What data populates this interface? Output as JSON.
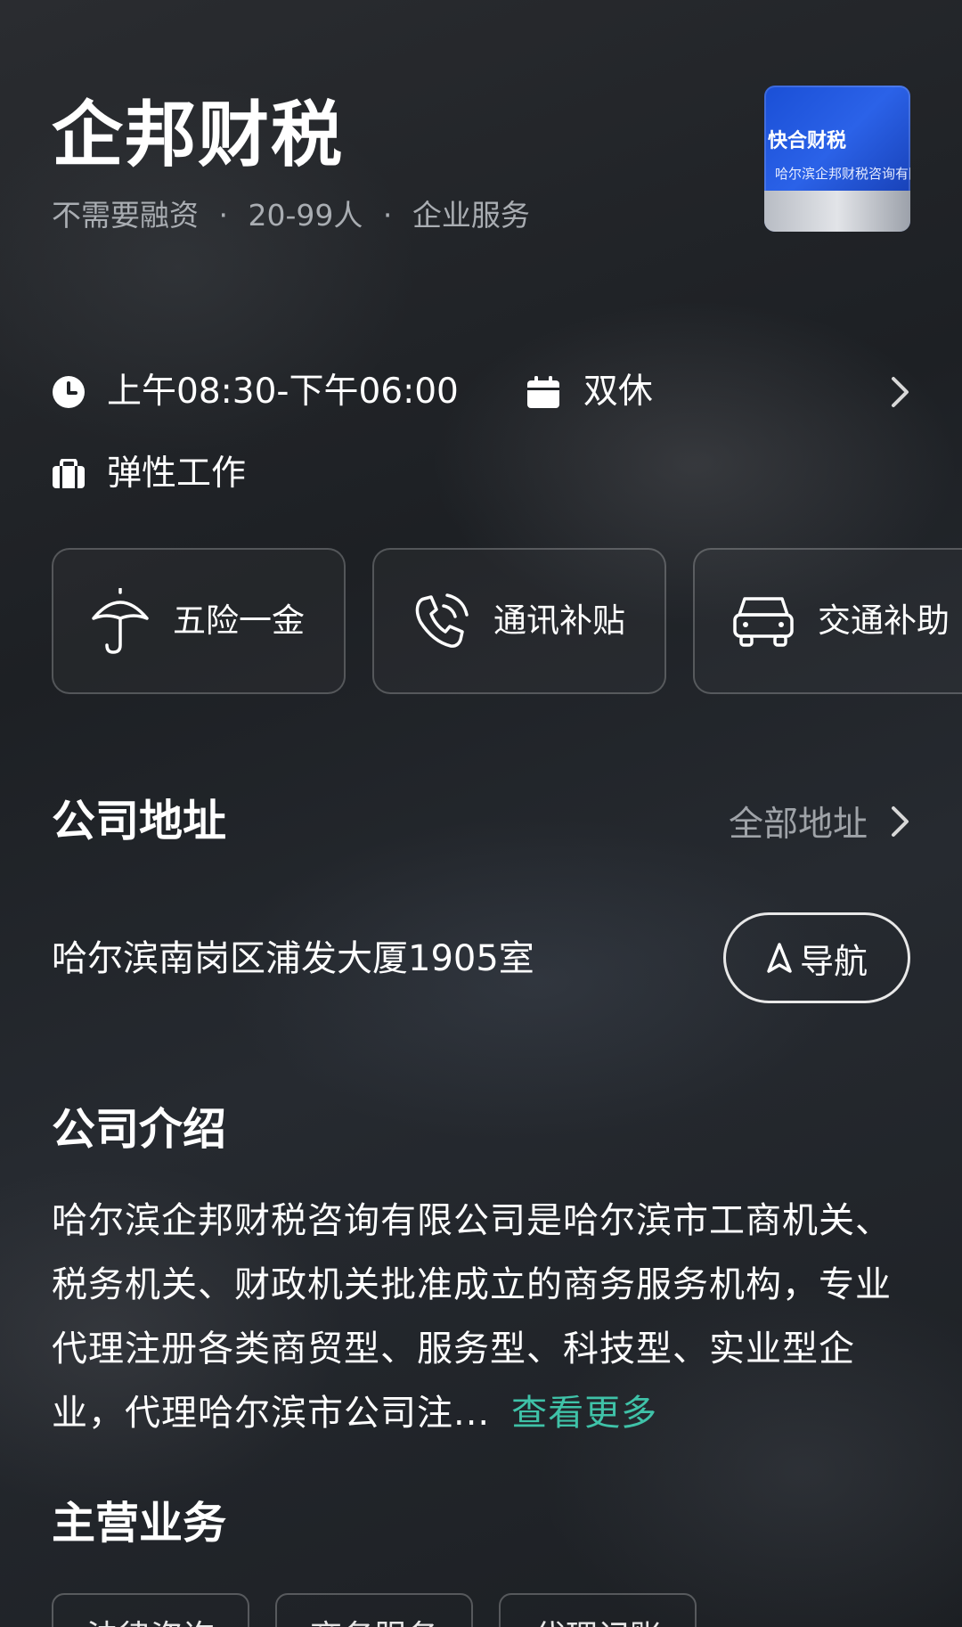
{
  "company": {
    "name": "企邦财税",
    "funding": "不需要融资",
    "size": "20-99人",
    "industry": "企业服务",
    "separator": "·",
    "logo_text_1": "快合财税",
    "logo_text_2": "哈尔滨企邦财税咨询有限"
  },
  "work": {
    "hours": "上午08:30-下午06:00",
    "rest": "双休",
    "schedule": "弹性工作"
  },
  "benefits": [
    {
      "label": "五险一金",
      "icon": "umbrella-icon"
    },
    {
      "label": "通讯补贴",
      "icon": "phone-icon"
    },
    {
      "label": "交通补助",
      "icon": "car-icon"
    }
  ],
  "address_section": {
    "title": "公司地址",
    "all_link": "全部地址",
    "address": "哈尔滨南岗区浦发大厦1905室",
    "nav_label": "导航"
  },
  "intro_section": {
    "title": "公司介绍",
    "text": "哈尔滨企邦财税咨询有限公司是哈尔滨市工商机关、税务机关、财政机关批准成立的商务服务机构，专业代理注册各类商贸型、服务型、科技型、实业型企业，代理哈尔滨市公司注...",
    "more_label": "查看更多"
  },
  "business_section": {
    "title": "主营业务",
    "tags": [
      "法律咨询",
      "商务服务",
      "代理记账"
    ]
  },
  "colors": {
    "accent": "#3fc2a8",
    "muted_text": "#a9adb2"
  }
}
